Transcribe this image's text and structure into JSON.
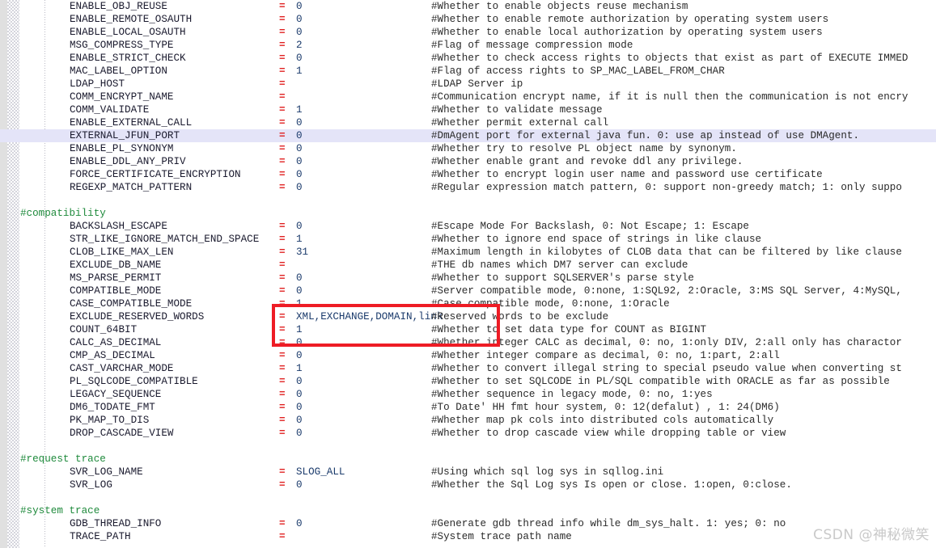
{
  "editor": {
    "highlight_color": "#e4e4f8",
    "annotation_color": "#ee1c25",
    "comment_color": "#2a2a2a",
    "section_color": "#1f8a3c",
    "equals_color": "#e02020",
    "value_color": "#1a3a6b",
    "key_color": "#1a1a2e"
  },
  "watermark": {
    "text": "CSDN @神秘微笑"
  },
  "lines": [
    {
      "type": "param",
      "key": "ENABLE_OBJ_REUSE",
      "eq": "=",
      "value": "0",
      "comment": "#Whether to enable objects reuse mechanism"
    },
    {
      "type": "param",
      "key": "ENABLE_REMOTE_OSAUTH",
      "eq": "=",
      "value": "0",
      "comment": "#Whether to enable remote authorization by operating system users"
    },
    {
      "type": "param",
      "key": "ENABLE_LOCAL_OSAUTH",
      "eq": "=",
      "value": "0",
      "comment": "#Whether to enable local authorization by operating system users"
    },
    {
      "type": "param",
      "key": "MSG_COMPRESS_TYPE",
      "eq": "=",
      "value": "2",
      "comment": "#Flag of message compression mode"
    },
    {
      "type": "param",
      "key": "ENABLE_STRICT_CHECK",
      "eq": "=",
      "value": "0",
      "comment": "#Whether to check access rights to objects that exist as part of EXECUTE IMMED"
    },
    {
      "type": "param",
      "key": "MAC_LABEL_OPTION",
      "eq": "=",
      "value": "1",
      "comment": "#Flag of access rights to SP_MAC_LABEL_FROM_CHAR"
    },
    {
      "type": "param",
      "key": "LDAP_HOST",
      "eq": "=",
      "value": "",
      "comment": "#LDAP Server ip"
    },
    {
      "type": "param",
      "key": "COMM_ENCRYPT_NAME",
      "eq": "=",
      "value": "",
      "comment": "#Communication encrypt name, if it is null then the communication is not encry"
    },
    {
      "type": "param",
      "key": "COMM_VALIDATE",
      "eq": "=",
      "value": "1",
      "comment": "#Whether to validate message"
    },
    {
      "type": "param",
      "key": "ENABLE_EXTERNAL_CALL",
      "eq": "=",
      "value": "0",
      "comment": "#Whether permit external call"
    },
    {
      "type": "param",
      "key": "EXTERNAL_JFUN_PORT",
      "eq": "=",
      "value": "0",
      "comment": "#DmAgent port for external java fun. 0: use ap instead of use DMAgent.",
      "highlight": true
    },
    {
      "type": "param",
      "key": "ENABLE_PL_SYNONYM",
      "eq": "=",
      "value": "0",
      "comment": "#Whether try to resolve PL object name by synonym."
    },
    {
      "type": "param",
      "key": "ENABLE_DDL_ANY_PRIV",
      "eq": "=",
      "value": "0",
      "comment": "#Whether enable grant and revoke ddl any privilege."
    },
    {
      "type": "param",
      "key": "FORCE_CERTIFICATE_ENCRYPTION",
      "eq": "=",
      "value": "0",
      "comment": "#Whether to encrypt login user name and password use certificate"
    },
    {
      "type": "param",
      "key": "REGEXP_MATCH_PATTERN",
      "eq": "=",
      "value": "0",
      "comment": "#Regular expression match pattern, 0: support non-greedy match; 1: only suppo"
    },
    {
      "type": "blank"
    },
    {
      "type": "section",
      "label": "#compatibility"
    },
    {
      "type": "param",
      "key": "BACKSLASH_ESCAPE",
      "eq": "=",
      "value": "0",
      "comment": "#Escape Mode For Backslash, 0: Not Escape; 1: Escape"
    },
    {
      "type": "param",
      "key": "STR_LIKE_IGNORE_MATCH_END_SPACE",
      "eq": "=",
      "value": "1",
      "comment": "#Whether to ignore end space of strings in like clause"
    },
    {
      "type": "param",
      "key": "CLOB_LIKE_MAX_LEN",
      "eq": "=",
      "value": "31",
      "comment": "#Maximum length in kilobytes of CLOB data that can be filtered by like clause"
    },
    {
      "type": "param",
      "key": "EXCLUDE_DB_NAME",
      "eq": "=",
      "value": "",
      "comment": "#THE db names which DM7 server can exclude"
    },
    {
      "type": "param",
      "key": "MS_PARSE_PERMIT",
      "eq": "=",
      "value": "0",
      "comment": "#Whether to support SQLSERVER's parse style"
    },
    {
      "type": "param",
      "key": "COMPATIBLE_MODE",
      "eq": "=",
      "value": "0",
      "comment": "#Server compatible mode, 0:none, 1:SQL92, 2:Oracle, 3:MS SQL Server, 4:MySQL,"
    },
    {
      "type": "param",
      "key": "CASE_COMPATIBLE_MODE",
      "eq": "=",
      "value": "1",
      "comment": "#Case compatible mode, 0:none, 1:Oracle"
    },
    {
      "type": "param",
      "key": "EXCLUDE_RESERVED_WORDS",
      "eq": "=",
      "value": "XML,EXCHANGE,DOMAIN,link",
      "comment": "#Reserved words to be exclude"
    },
    {
      "type": "param",
      "key": "COUNT_64BIT",
      "eq": "=",
      "value": "1",
      "comment": "#Whether to set data type for COUNT as BIGINT"
    },
    {
      "type": "param",
      "key": "CALC_AS_DECIMAL",
      "eq": "=",
      "value": "0",
      "comment": "#Whether integer CALC as decimal, 0: no, 1:only DIV, 2:all only has charactor"
    },
    {
      "type": "param",
      "key": "CMP_AS_DECIMAL",
      "eq": "=",
      "value": "0",
      "comment": "#Whether integer compare as decimal, 0: no, 1:part, 2:all"
    },
    {
      "type": "param",
      "key": "CAST_VARCHAR_MODE",
      "eq": "=",
      "value": "1",
      "comment": "#Whether to convert illegal string to special pseudo value when converting st"
    },
    {
      "type": "param",
      "key": "PL_SQLCODE_COMPATIBLE",
      "eq": "=",
      "value": "0",
      "comment": "#Whether to set SQLCODE in PL/SQL compatible with ORACLE as far as possible"
    },
    {
      "type": "param",
      "key": "LEGACY_SEQUENCE",
      "eq": "=",
      "value": "0",
      "comment": "#Whether sequence in legacy mode, 0: no, 1:yes"
    },
    {
      "type": "param",
      "key": "DM6_TODATE_FMT",
      "eq": "=",
      "value": "0",
      "comment": "#To Date' HH fmt hour system, 0: 12(defalut) , 1: 24(DM6)"
    },
    {
      "type": "param",
      "key": "PK_MAP_TO_DIS",
      "eq": "=",
      "value": "0",
      "comment": "#Whether map pk cols into distributed cols automatically"
    },
    {
      "type": "param",
      "key": "DROP_CASCADE_VIEW",
      "eq": "=",
      "value": "0",
      "comment": "#Whether to drop cascade view while dropping table or view"
    },
    {
      "type": "blank"
    },
    {
      "type": "section",
      "label": "#request trace"
    },
    {
      "type": "param",
      "key": "SVR_LOG_NAME",
      "eq": "=",
      "value": "SLOG_ALL",
      "comment": "#Using which sql log sys in sqllog.ini"
    },
    {
      "type": "param",
      "key": "SVR_LOG",
      "eq": "=",
      "value": "0",
      "comment": "#Whether the Sql Log sys Is open or close. 1:open, 0:close."
    },
    {
      "type": "blank"
    },
    {
      "type": "section",
      "label": "#system trace"
    },
    {
      "type": "param",
      "key": "GDB_THREAD_INFO",
      "eq": "=",
      "value": "0",
      "comment": "#Generate gdb thread info while dm_sys_halt. 1: yes; 0: no"
    },
    {
      "type": "param",
      "key": "TRACE_PATH",
      "eq": "=",
      "value": "",
      "comment": "#System trace path name"
    }
  ]
}
